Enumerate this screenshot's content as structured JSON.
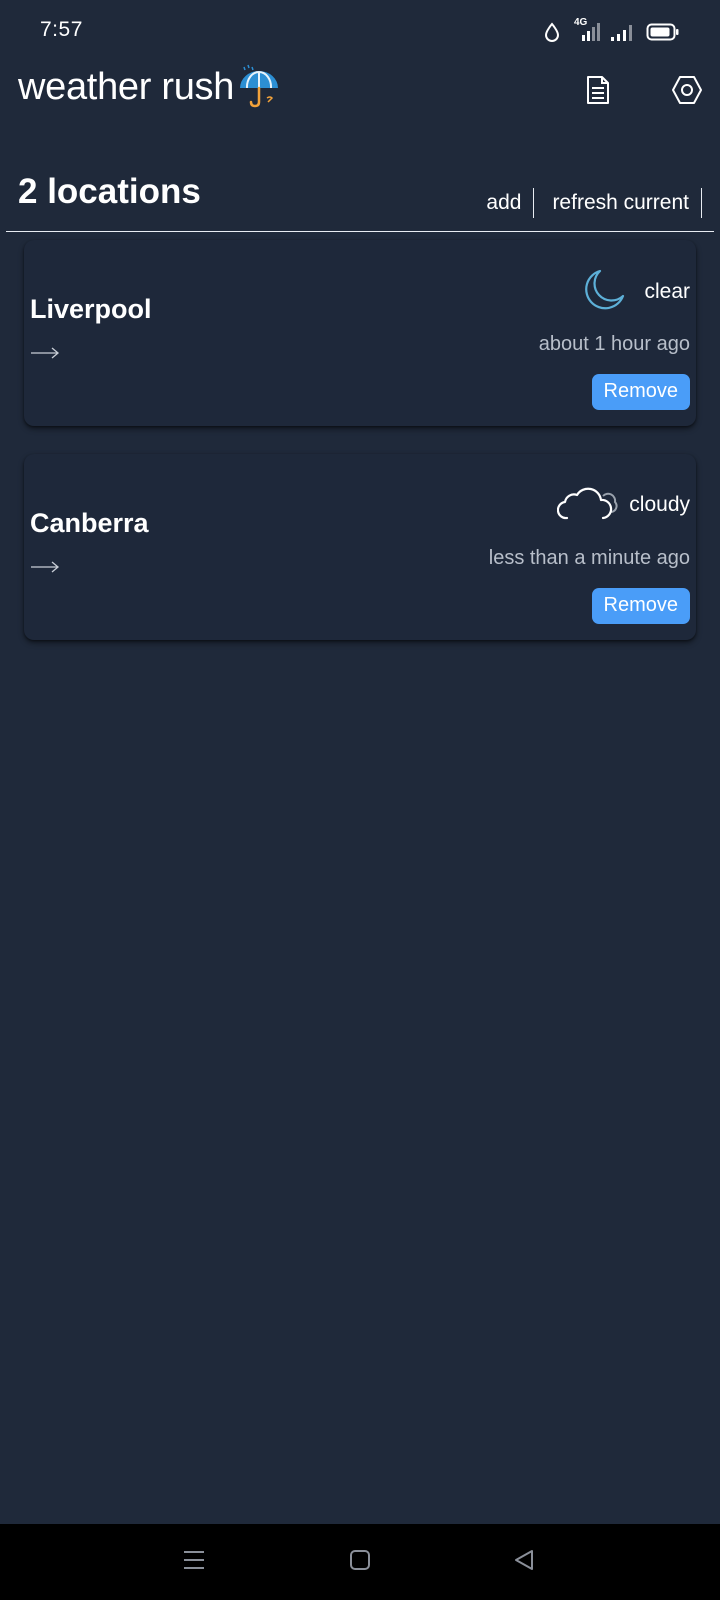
{
  "status_bar": {
    "time": "7:57",
    "network_label": "4G",
    "icons": [
      "water-drop-icon",
      "signal-4g-icon",
      "signal-icon",
      "battery-icon"
    ]
  },
  "app_bar": {
    "title": "weather rush",
    "logo_icon": "umbrella-rain-icon",
    "actions": [
      {
        "icon": "document-icon"
      },
      {
        "icon": "settings-hexagon-icon"
      }
    ]
  },
  "locations_header": {
    "count_label": "2 locations",
    "add_label": "add",
    "refresh_label": "refresh current"
  },
  "locations": [
    {
      "city": "Liverpool",
      "condition": "clear",
      "condition_icon": "moon-icon",
      "updated": "about 1 hour ago",
      "remove_label": "Remove"
    },
    {
      "city": "Canberra",
      "condition": "cloudy",
      "condition_icon": "cloud-icon",
      "updated": "less than a minute ago",
      "remove_label": "Remove"
    }
  ],
  "nav_bar": {
    "buttons": [
      "menu-icon",
      "home-icon",
      "back-icon"
    ]
  },
  "colors": {
    "background": "#1f293a",
    "accent": "#4a9df8",
    "muted_text": "#b8bfca",
    "moon": "#5db0d8"
  }
}
